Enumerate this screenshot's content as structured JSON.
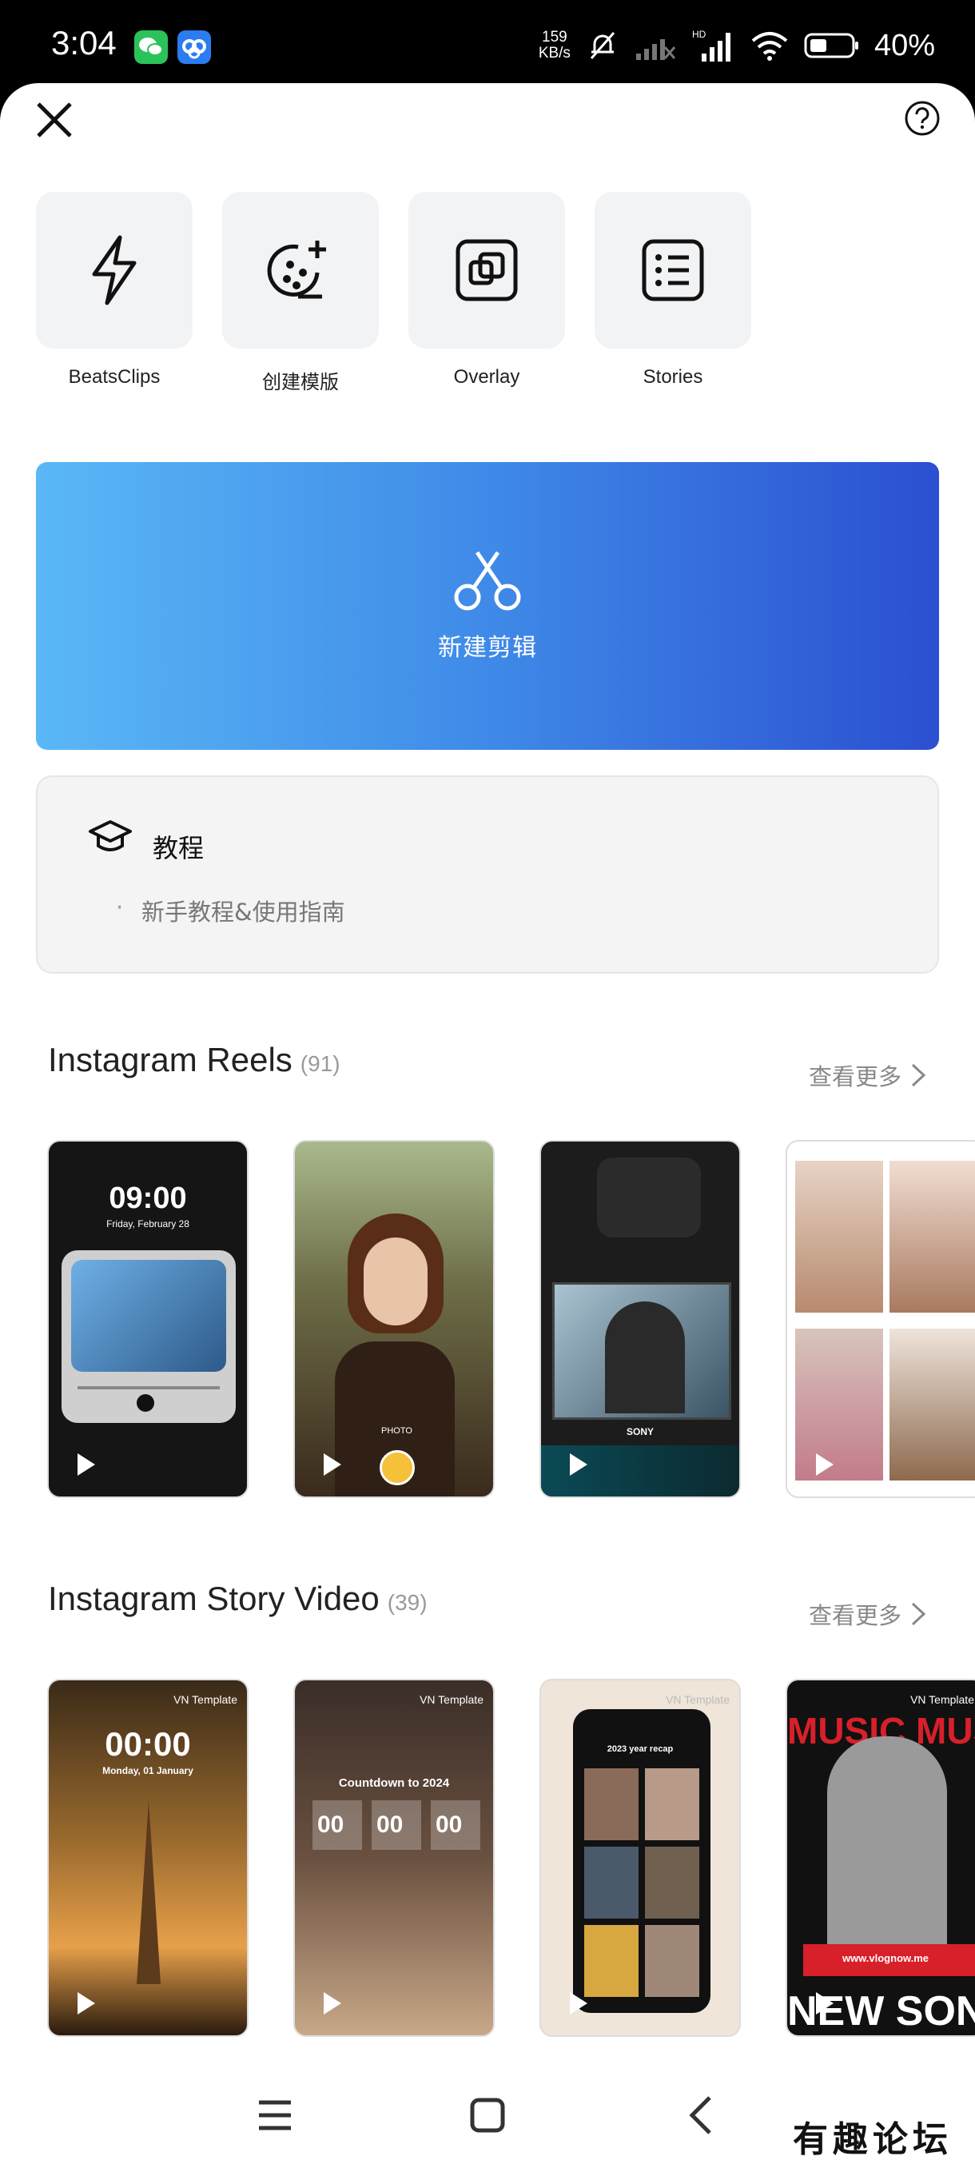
{
  "status": {
    "time": "3:04",
    "speed_value": "159",
    "speed_unit": "KB/s",
    "battery": "40%"
  },
  "tools": [
    {
      "label": "BeatsClips",
      "icon": "lightning-icon"
    },
    {
      "label": "创建模版",
      "icon": "template-create-icon"
    },
    {
      "label": "Overlay",
      "icon": "overlay-icon"
    },
    {
      "label": "Stories",
      "icon": "stories-list-icon"
    }
  ],
  "new_edit": {
    "label": "新建剪辑",
    "icon": "scissors-icon"
  },
  "tutorial": {
    "title": "教程",
    "item": "新手教程&使用指南"
  },
  "sections": [
    {
      "title": "Instagram Reels",
      "count": "(91)",
      "see_more": "查看更多"
    },
    {
      "title": "Instagram Story Video",
      "count": "(39)",
      "see_more": "查看更多"
    }
  ],
  "reels_thumbs": [
    {
      "time": "09:00",
      "date": "Friday, February 28"
    },
    {
      "text": "PHOTO"
    },
    {
      "text": "SONY"
    },
    {
      "text": ""
    }
  ],
  "story_thumbs": [
    {
      "tag": "VN Template",
      "time": "00:00",
      "date": "Monday, 01 January"
    },
    {
      "tag": "VN Template",
      "title": "Countdown to 2024",
      "d1": "00",
      "d2": "00",
      "d3": "00"
    },
    {
      "tag": "VN Template",
      "title": "2023 year recap"
    },
    {
      "tag": "VN Template",
      "top": "MUSIC MUSI",
      "site": "www.vlognow.me",
      "bottom": "NEW SONG"
    }
  ],
  "watermark": "有趣论坛",
  "colors": {
    "accent_start": "#5ab8f6",
    "accent_end": "#2b4fd1"
  }
}
